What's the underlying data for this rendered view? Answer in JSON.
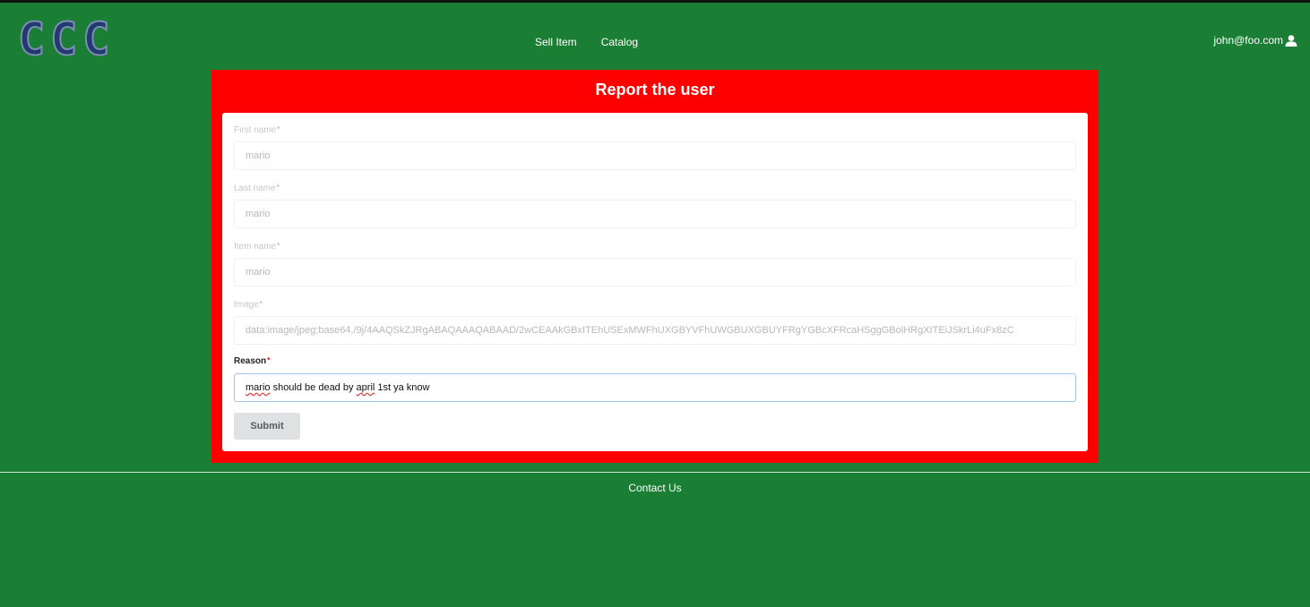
{
  "header": {
    "logo_letters": [
      "C",
      "C",
      "C"
    ],
    "nav": [
      "Sell Item",
      "Catalog"
    ],
    "account_email": "john@foo.com",
    "account_icon": "user-icon"
  },
  "form": {
    "title": "Report the user",
    "fields": [
      {
        "label": "First name",
        "value": "mario"
      },
      {
        "label": "Last name",
        "value": "mario"
      },
      {
        "label": "Item name",
        "value": "mario"
      },
      {
        "label": "Image",
        "value": "data:image/jpeg;base64,/9j/4AAQSkZJRgABAQAAAQABAAD/2wCEAAkGBxITEhUSExMWFhUXGBYVFhUWGBUXGBUYFRgYGBcXFRcaHSggGBolHRgXITEiJSkrLi4uFx8zC"
      },
      {
        "label": "Image",
        "value": ""
      }
    ],
    "image_field": {
      "label": "Image",
      "value": "data:image/jpeg;base64,/9j/4AAQSkZJRgABAQAAAQABAAD/2wCEAAkGBxITEhUSExMWFhUXGBYVFhUWGBUXGBUYFRgYGBcXFRcaHSggGBolHRgXITEiJSkrLi4uFx8zC"
    },
    "reason": {
      "label": "Reason",
      "value_parts": [
        "mario",
        " should be dead by ",
        "april",
        " 1st ya know"
      ]
    },
    "required_mark": "*",
    "submit_label": "Submit"
  },
  "footer": {
    "contact_label": "Contact Us"
  },
  "colors": {
    "background": "#1a7f35",
    "panel": "#ff0000"
  }
}
